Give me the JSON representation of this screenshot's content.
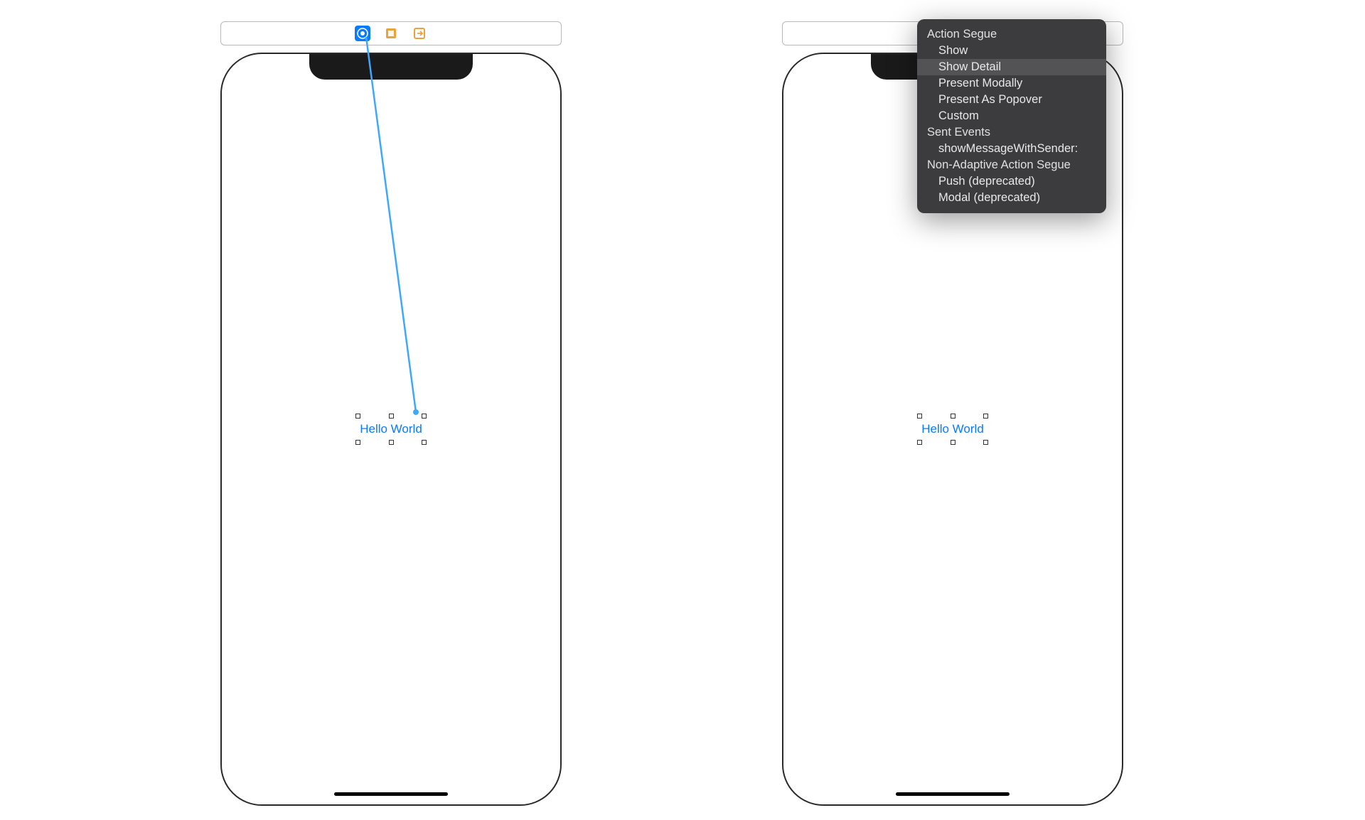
{
  "buttonText": "Hello World",
  "popup": {
    "sections": [
      {
        "header": "Action Segue",
        "items": [
          {
            "label": "Show",
            "highlighted": false
          },
          {
            "label": "Show Detail",
            "highlighted": true
          },
          {
            "label": "Present Modally",
            "highlighted": false
          },
          {
            "label": "Present As Popover",
            "highlighted": false
          },
          {
            "label": "Custom",
            "highlighted": false
          }
        ]
      },
      {
        "header": "Sent Events",
        "items": [
          {
            "label": "showMessageWithSender:",
            "highlighted": false
          }
        ]
      },
      {
        "header": "Non-Adaptive Action Segue",
        "items": [
          {
            "label": "Push (deprecated)",
            "highlighted": false
          },
          {
            "label": "Modal (deprecated)",
            "highlighted": false
          }
        ]
      }
    ]
  }
}
